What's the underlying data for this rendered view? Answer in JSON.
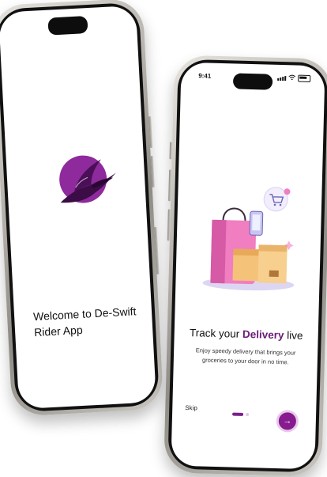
{
  "welcome_screen": {
    "title": "Welcome to De-Swift Rider App",
    "logo_icon": "swift-bird-logo-icon",
    "brand_color": "#6a1b78"
  },
  "onboarding_screen": {
    "status_time": "9:41",
    "title_prefix": "Track your",
    "title_highlight": "Delivery",
    "title_suffix": "live",
    "subtitle": "Enjoy speedy delivery that brings your groceries to your door in no time.",
    "skip_label": "Skip",
    "next_icon": "arrow-right-icon",
    "page_indicator": {
      "current": 1,
      "total": 3
    },
    "accent_color": "#861a8e"
  }
}
